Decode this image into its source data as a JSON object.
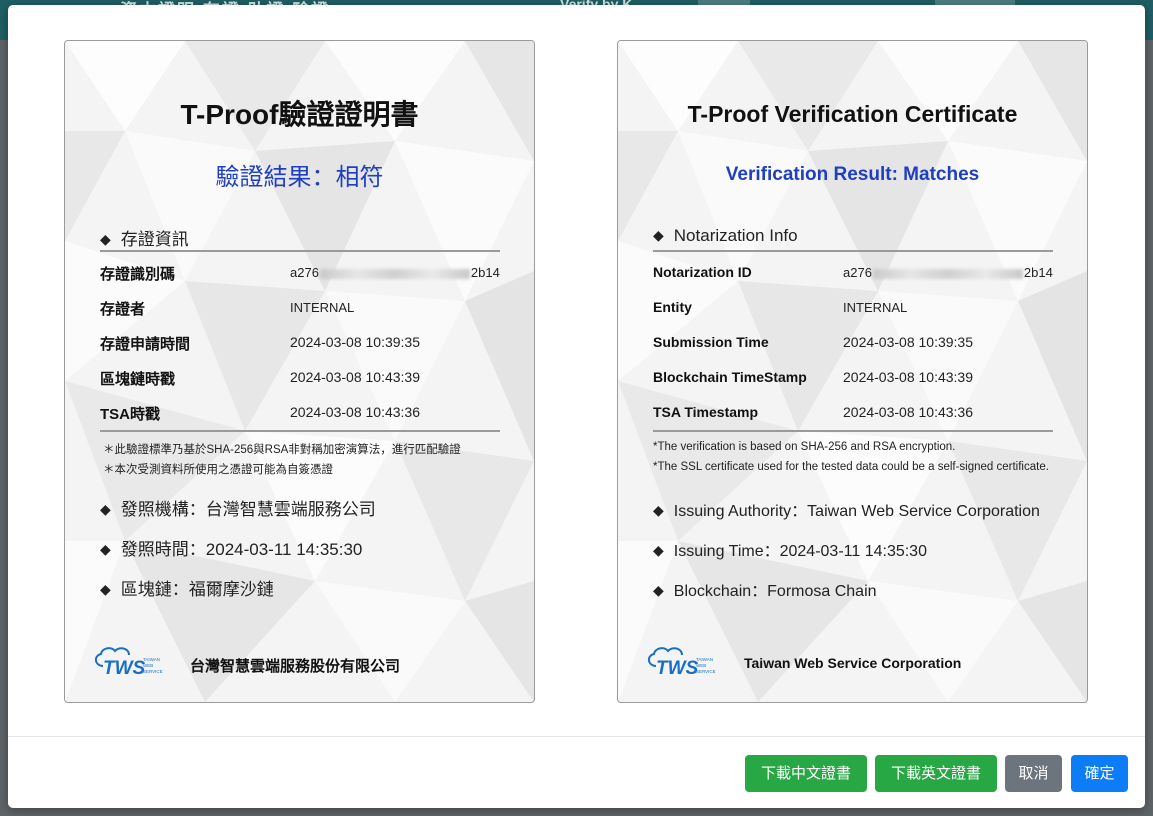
{
  "background": {
    "topbar_text": "資本證明 存證 助證 驗證",
    "topbar_right": "Verify by K..."
  },
  "left_cert": {
    "title": "T-Proof驗證證明書",
    "result": "驗證結果：相符",
    "section": "存證資訊",
    "rows": [
      {
        "label": "存證識別碼",
        "value_prefix": "a276",
        "value_suffix": "2b14"
      },
      {
        "label": "存證者",
        "value": "INTERNAL"
      },
      {
        "label": "存證申請時間",
        "value": "2024-03-08 10:39:35"
      },
      {
        "label": "區塊鏈時戳",
        "value": "2024-03-08 10:43:39"
      },
      {
        "label": "TSA時戳",
        "value": "2024-03-08 10:43:36"
      }
    ],
    "notes": [
      "＊此驗證標準乃基於SHA-256與RSA非對稱加密演算法，進行匹配驗證",
      "＊本次受測資料所使用之憑證可能為自簽憑證"
    ],
    "bullets": [
      "發照機構：台灣智慧雲端服務公司",
      "發照時間：2024-03-11 14:35:30",
      "區塊鏈：福爾摩沙鏈"
    ],
    "company": "台灣智慧雲端服務股份有限公司"
  },
  "right_cert": {
    "title": "T-Proof Verification Certificate",
    "result": "Verification Result: Matches",
    "section": "Notarization Info",
    "rows": [
      {
        "label": "Notarization ID",
        "value_prefix": "a276",
        "value_suffix": "2b14"
      },
      {
        "label": "Entity",
        "value": "INTERNAL"
      },
      {
        "label": "Submission Time",
        "value": "2024-03-08 10:39:35"
      },
      {
        "label": "Blockchain TimeStamp",
        "value": "2024-03-08 10:43:39"
      },
      {
        "label": "TSA Timestamp",
        "value": "2024-03-08 10:43:36"
      }
    ],
    "notes": [
      "*The verification is based on SHA-256 and RSA encryption.",
      "*The SSL certificate used for the tested data could be a self-signed certificate."
    ],
    "bullets": [
      "Issuing Authority：Taiwan Web Service Corporation",
      "Issuing Time：2024-03-11 14:35:30",
      "Blockchain：Formosa Chain"
    ],
    "company": "Taiwan Web Service Corporation"
  },
  "logo": {
    "main": "TWS",
    "small_lines": [
      "TAIWAN",
      "WEB",
      "SERVICE"
    ]
  },
  "footer": {
    "download_zh": "下載中文證書",
    "download_en": "下載英文證書",
    "cancel": "取消",
    "confirm": "確定"
  },
  "colors": {
    "result_blue": "#1f3fbf",
    "green": "#28a745",
    "gray": "#6c757d",
    "blue": "#0d7cf7",
    "logo_blue": "#1a6fc4"
  }
}
